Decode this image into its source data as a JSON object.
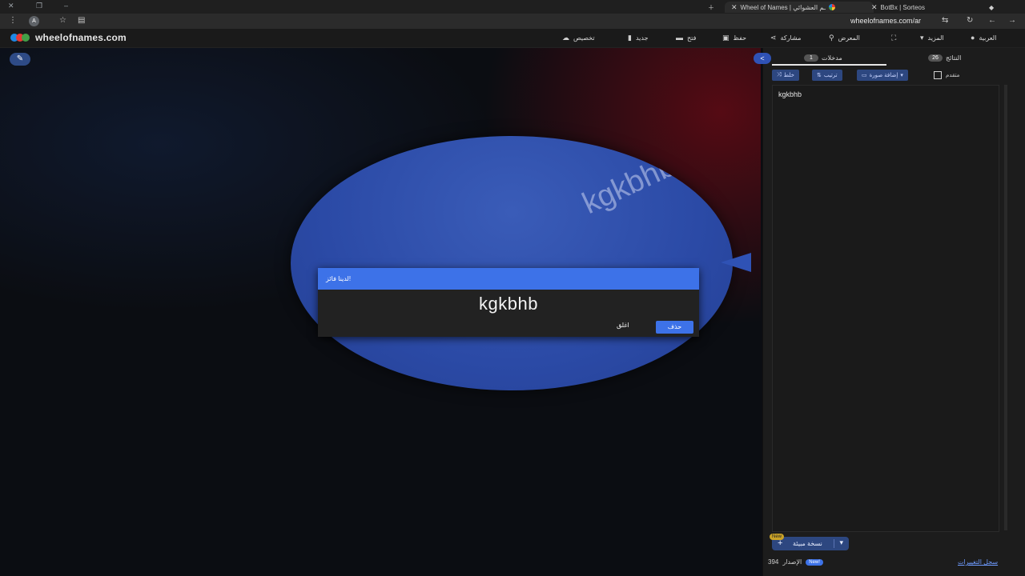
{
  "browser": {
    "tabs": [
      {
        "title": "Wheel of Names | ـم العشوائي"
      },
      {
        "title": "BotBx | Sorteos"
      }
    ],
    "url": "wheelofnames.com/ar",
    "profile_initial": "A"
  },
  "app": {
    "site_name": "wheelofnames.com",
    "menu": [
      {
        "label": "تخصيص",
        "icon": "palette-icon"
      },
      {
        "label": "جديد",
        "icon": "file-icon"
      },
      {
        "label": "فتح",
        "icon": "folder-icon"
      },
      {
        "label": "حفظ",
        "icon": "save-icon"
      },
      {
        "label": "مشاركة",
        "icon": "share-icon"
      },
      {
        "label": "المعرض",
        "icon": "search-icon"
      },
      {
        "label": "المزيد",
        "icon": "chevron-down-icon"
      },
      {
        "label": "العربية",
        "icon": "globe-icon"
      }
    ]
  },
  "wheel": {
    "segment_text": "kgkbhb",
    "color": "#2b4aa6"
  },
  "dialog": {
    "title": "لدينا فائز!",
    "winner": "kgkbhb",
    "close_label": "اغلق",
    "remove_label": "حذف"
  },
  "panel": {
    "tab_entries_label": "مدخلات",
    "tab_entries_count": "1",
    "tab_results_label": "النتائج",
    "tab_results_count": "26",
    "tools": {
      "shuffle_label": "خلط",
      "sort_label": "ترتيب",
      "add_image_label": "إضافة صورة",
      "advanced_label": "متقدم"
    },
    "entries": [
      "kgkbhb"
    ],
    "preset_label": "نسخة مبيئة",
    "preset_badge": "New",
    "version_label": "الإصدار",
    "version_number": "394",
    "version_badge": "New!",
    "changelog_link": "سجل التغييرات"
  }
}
